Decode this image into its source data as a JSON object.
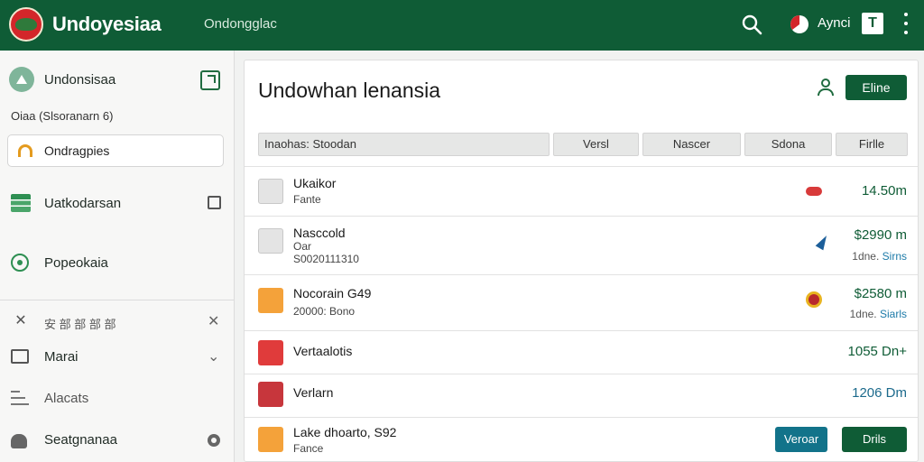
{
  "header": {
    "app_title": "Undoyesiaa",
    "subtitle": "Ondongglac",
    "user_label": "Aynci",
    "t_button": "T"
  },
  "sidebar": {
    "profile_name": "Undonsisaa",
    "sub_text": "Oiaa (Slsoranarn 6)",
    "search_placeholder": "Ondragpies",
    "items": [
      {
        "label": "Uatkodarsan",
        "icon": "spreadsheet-icon"
      },
      {
        "label": "Popeokaia",
        "icon": "gear-icon"
      },
      {
        "label": "安 部 部 部 部",
        "icon": "mark-icon"
      },
      {
        "label": "Marai",
        "icon": "monitor-icon"
      },
      {
        "label": "Alacats",
        "icon": "list-icon"
      },
      {
        "label": "Seatgnanaa",
        "icon": "person-icon"
      }
    ]
  },
  "main": {
    "title": "Undowhan lenansia",
    "primary_button": "Eline",
    "filters": [
      "Inaohas: Stoodan",
      "Versl",
      "Nascer",
      "Sdona",
      "Firlle"
    ],
    "rows": [
      {
        "title": "Ukaikor",
        "sub": "Fante",
        "amount": "14.50m",
        "icon": "tag-icon"
      },
      {
        "title": "Nasccold",
        "sub1": "Oar",
        "sub2": "S0020111310",
        "amount": "$2990 m",
        "note_prefix": "1dne.",
        "note_link": "Sirns",
        "icon": "arrow-icon"
      },
      {
        "title": "Nocorain G49",
        "sub": "20000: Bono",
        "amount": "$2580 m",
        "note_prefix": "1dne.",
        "note_link": "Siarls",
        "icon": "ball-icon"
      },
      {
        "title": "Vertaalotis",
        "amount": "1055 Dn+"
      },
      {
        "title": "Verlarn",
        "amount": "1206 Dm"
      },
      {
        "title": "Lake dhoarto, S92",
        "sub": "Fance",
        "button_teal": "Veroar",
        "button_green": "Drils"
      }
    ]
  },
  "colors": {
    "brand_green": "#0f5c36",
    "accent_teal": "#12738a",
    "amount_blue": "#1c6a8c"
  }
}
